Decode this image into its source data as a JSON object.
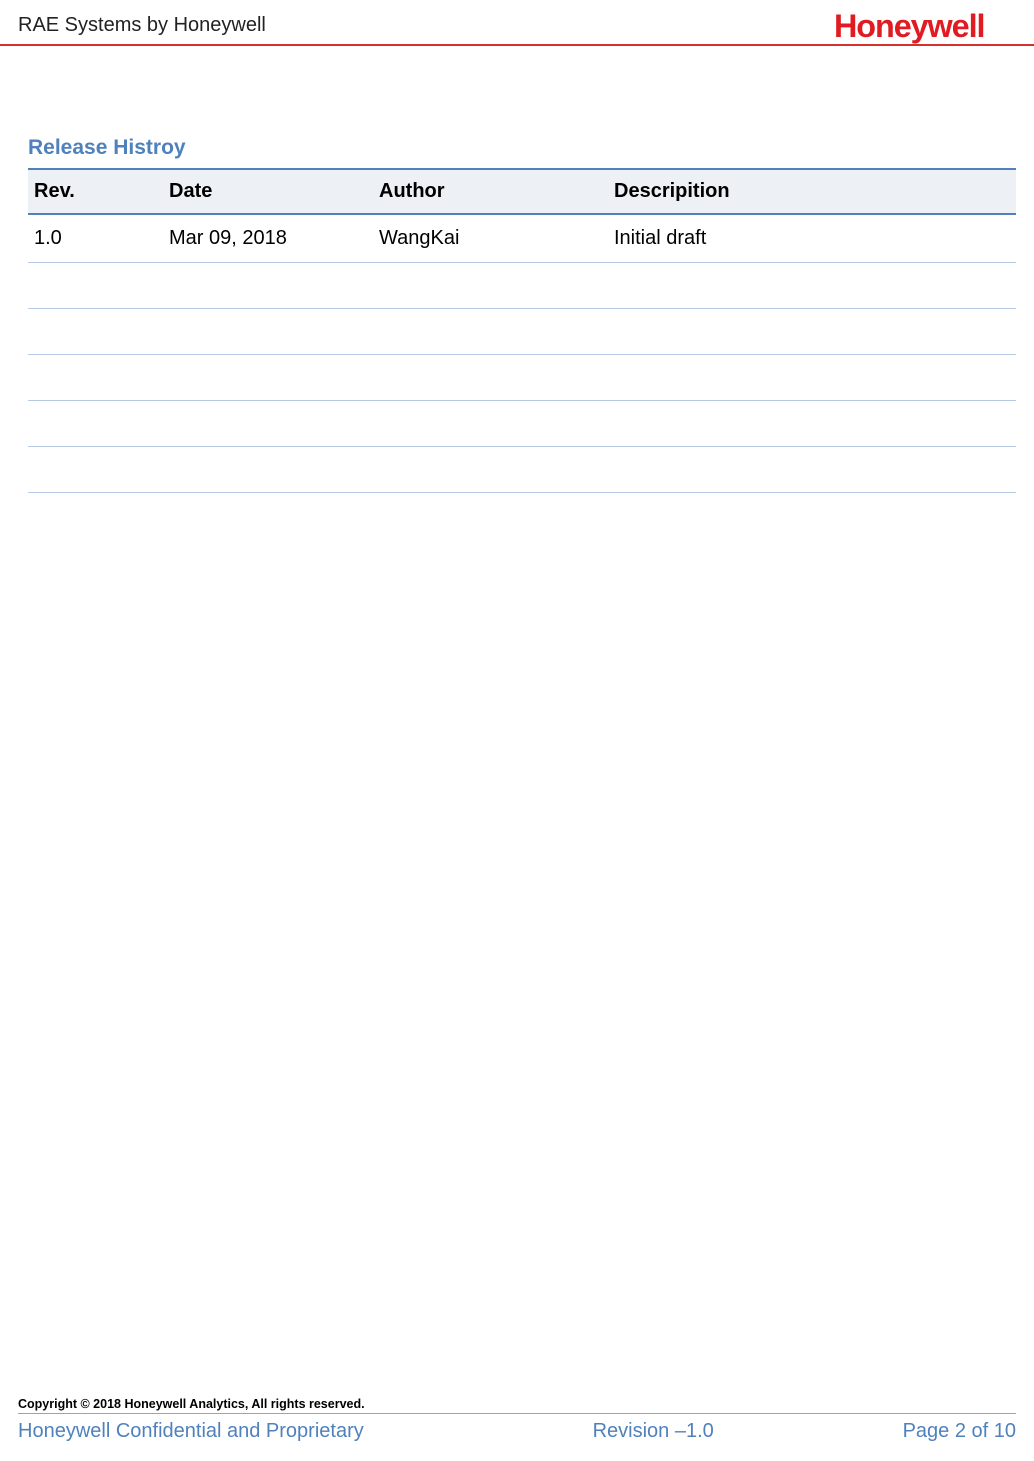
{
  "header": {
    "title": "RAE Systems by Honeywell",
    "logo_text": "Honeywell"
  },
  "section": {
    "title": "Release Histroy"
  },
  "table": {
    "headers": {
      "rev": "Rev.",
      "date": "Date",
      "author": "Author",
      "description": "Descripition"
    },
    "rows": [
      {
        "rev": "1.0",
        "date": "Mar 09, 2018",
        "author": "WangKai",
        "description": "Initial draft"
      },
      {
        "rev": "",
        "date": "",
        "author": "",
        "description": ""
      },
      {
        "rev": "",
        "date": "",
        "author": "",
        "description": ""
      },
      {
        "rev": "",
        "date": "",
        "author": "",
        "description": ""
      },
      {
        "rev": "",
        "date": "",
        "author": "",
        "description": ""
      },
      {
        "rev": "",
        "date": "",
        "author": "",
        "description": ""
      }
    ]
  },
  "footer": {
    "copyright": "Copyright © 2018 Honeywell Analytics, All rights reserved.",
    "confidential": "Honeywell Confidential and Proprietary",
    "revision": "Revision –1.0",
    "page": "Page 2 of 10"
  }
}
